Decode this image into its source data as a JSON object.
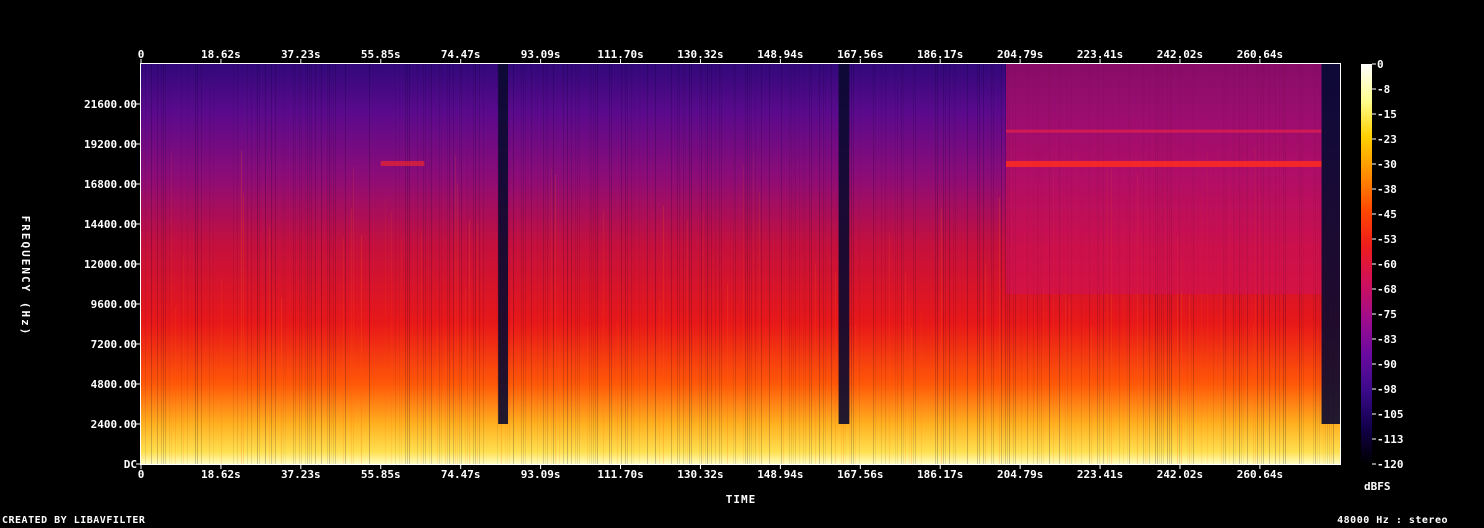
{
  "footer": {
    "credit": "CREATED BY LIBAVFILTER",
    "info": "48000 Hz : stereo"
  },
  "chart_data": {
    "type": "heatmap",
    "xlabel": "TIME",
    "ylabel": "FREQUENCY (Hz)",
    "colorbar_label": "dBFS",
    "x_ticks": [
      "0",
      "18.62s",
      "37.23s",
      "55.85s",
      "74.47s",
      "93.09s",
      "111.70s",
      "130.32s",
      "148.94s",
      "167.56s",
      "186.17s",
      "204.79s",
      "223.41s",
      "242.02s",
      "260.64s"
    ],
    "x_tick_values": [
      0,
      18.62,
      37.23,
      55.85,
      74.47,
      93.09,
      111.7,
      130.32,
      148.94,
      167.56,
      186.17,
      204.79,
      223.41,
      242.02,
      260.64
    ],
    "xlim": [
      0,
      279.3
    ],
    "y_ticks": [
      "DC",
      "2400.00",
      "4800.00",
      "7200.00",
      "9600.00",
      "12000.00",
      "14400.00",
      "16800.00",
      "19200.00",
      "21600.00"
    ],
    "y_tick_values": [
      0,
      2400,
      4800,
      7200,
      9600,
      12000,
      14400,
      16800,
      19200,
      21600
    ],
    "ylim": [
      0,
      24000
    ],
    "colorbar_ticks": [
      "0",
      "-8",
      "-15",
      "-23",
      "-30",
      "-38",
      "-45",
      "-53",
      "-60",
      "-68",
      "-75",
      "-83",
      "-90",
      "-98",
      "-105",
      "-113",
      "-120"
    ],
    "colorbar_range": [
      -120,
      0
    ],
    "colormap": [
      "#000000",
      "#12004a",
      "#3a0a8a",
      "#6a0aa0",
      "#a00c8c",
      "#d0105a",
      "#ee1c1c",
      "#ff4a00",
      "#ff9000",
      "#ffd000",
      "#ffff90",
      "#ffffff"
    ],
    "quiet_sections_s": [
      [
        83.2,
        85.5
      ],
      [
        162.5,
        165.0
      ],
      [
        275.0,
        279.3
      ]
    ],
    "bright_section_s": [
      201.5,
      275.0
    ]
  }
}
